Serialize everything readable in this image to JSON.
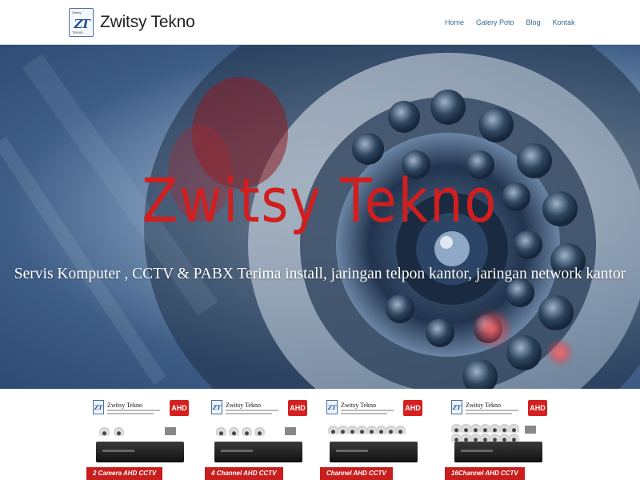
{
  "header": {
    "brand_name": "Zwitsy Tekno",
    "logo_mark": "ZT",
    "logo_top": "Zwitsy",
    "logo_bottom": "TEKNO",
    "nav": [
      "Home",
      "Galery Poto",
      "Blog",
      "Kontak"
    ]
  },
  "hero": {
    "title": "Zwitsy Tekno",
    "subtitle": "Servis Komputer , CCTV & PABX Terima install, jaringan telpon kantor, jaringan network kantor",
    "title_color": "#d11e1e"
  },
  "products": [
    {
      "brand": "Zwitsy Tekno",
      "badge": "AHD",
      "logo": "ZT",
      "label": "2 Camera AHD CCTV",
      "cameras": 2
    },
    {
      "brand": "Zwitsy Tekno",
      "badge": "AHD",
      "logo": "ZT",
      "label": "4 Channel AHD CCTV",
      "cameras": 4
    },
    {
      "brand": "Zwitsy Tekno",
      "badge": "AHD",
      "logo": "ZT",
      "label": "Channel AHD CCTV",
      "cameras": 8
    },
    {
      "brand": "Zwitsy Tekno",
      "badge": "AHD",
      "logo": "ZT",
      "label": "16Channel AHD CCTV",
      "cameras": 16
    }
  ]
}
